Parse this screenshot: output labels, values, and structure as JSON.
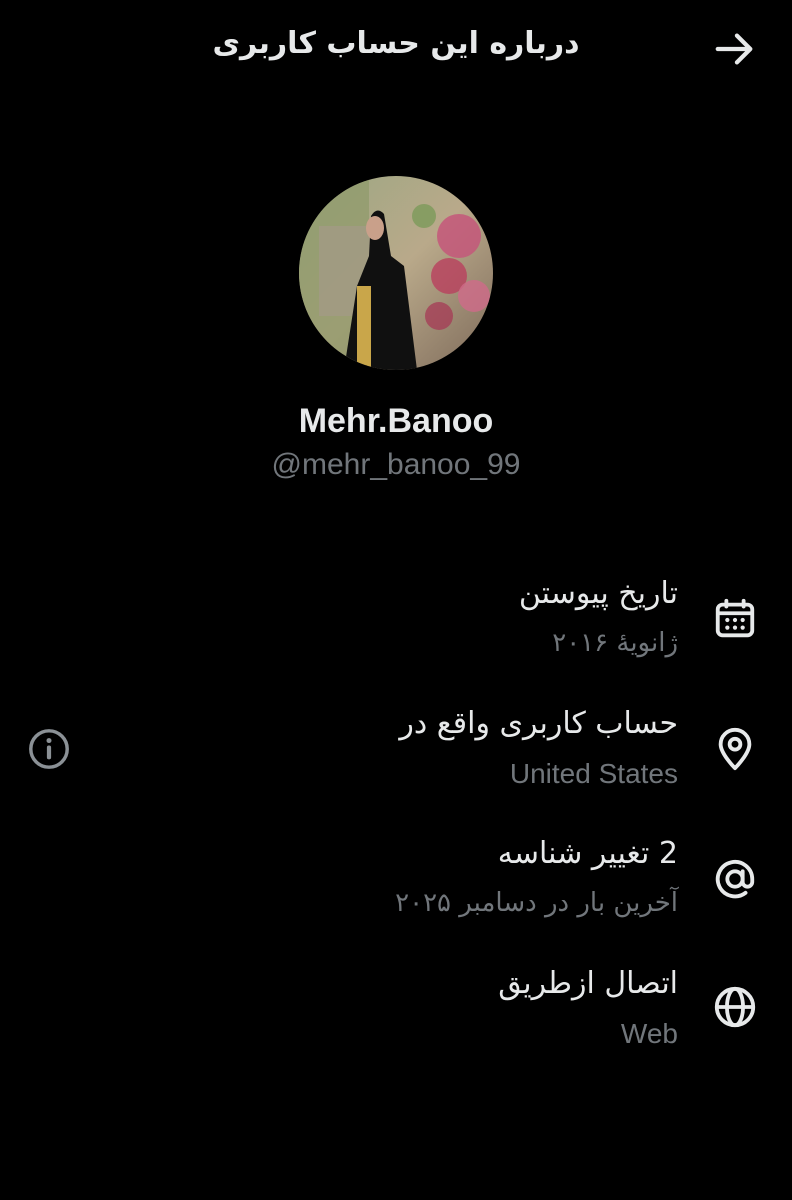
{
  "header": {
    "title": "درباره این حساب کاربری",
    "back_icon": "arrow-right-icon"
  },
  "profile": {
    "display_name": "Mehr.Banoo",
    "handle": "@mehr_banoo_99"
  },
  "rows": [
    {
      "icon": "calendar-icon",
      "label": "تاریخ پیوستن",
      "value": "ژانویهٔ ۲۰۱۶"
    },
    {
      "icon": "location-pin-icon",
      "label": "حساب کاربری واقع در",
      "value": "United States"
    },
    {
      "icon": "at-sign-icon",
      "label": "2 تغییر شناسه",
      "value": "آخرین بار در دسامبر ۲۰۲۵"
    },
    {
      "icon": "globe-icon",
      "label": "اتصال ازطریق",
      "value": "Web"
    }
  ],
  "info_icon": "info-icon",
  "colors": {
    "background": "#000000",
    "primary_text": "#e7e9ea",
    "secondary_text": "#71767b"
  }
}
